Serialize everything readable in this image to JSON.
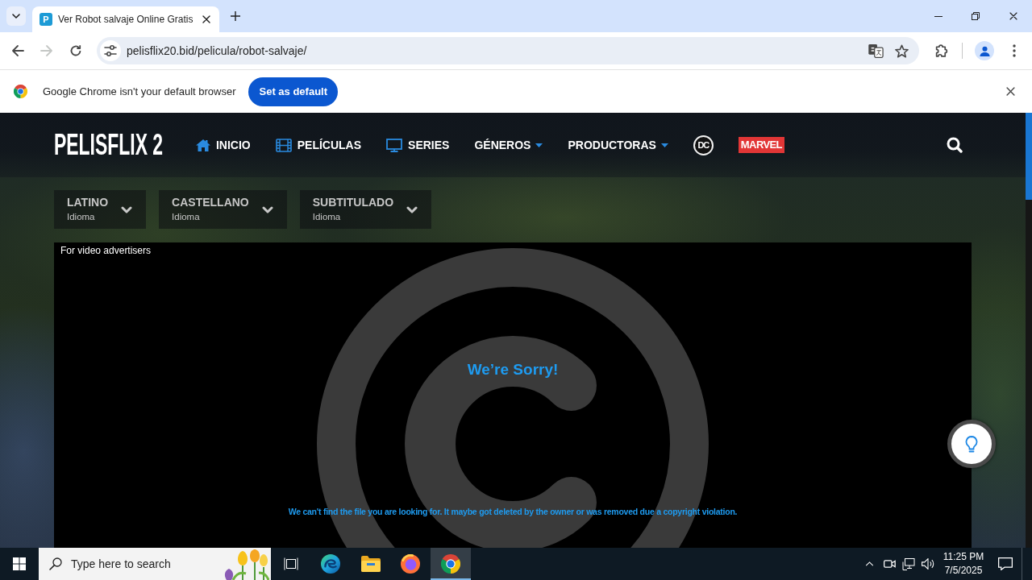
{
  "browser": {
    "tabs": [
      {
        "title": "Ver Robot salvaje Online Gratis",
        "favicon_text": "P",
        "selected": true
      }
    ],
    "toolbar": {
      "buttons": [
        {
          "kind": "back",
          "disabled": false
        },
        {
          "kind": "forward",
          "disabled": true
        },
        {
          "kind": "reload",
          "disabled": false
        }
      ],
      "url": "pelisflix20.bid/pelicula/robot-salvaje/"
    },
    "infobar": {
      "message": "Google Chrome isn't your default browser",
      "button": "Set as default"
    }
  },
  "site": {
    "logo": "PELISFLIX 2",
    "nav": [
      {
        "kind": "home",
        "label": "INICIO"
      },
      {
        "kind": "film",
        "label": "PELÍCULAS"
      },
      {
        "kind": "tv",
        "label": "SERIES"
      },
      {
        "kind": "dropdown",
        "label": "GÉNEROS"
      },
      {
        "kind": "dropdown",
        "label": "PRODUCTORAS"
      },
      {
        "kind": "circle-logo",
        "label": "DC"
      },
      {
        "kind": "box-logo",
        "label": "MARVEL"
      }
    ],
    "languages": [
      {
        "title": "LATINO",
        "subtitle": "Idioma"
      },
      {
        "title": "CASTELLANO",
        "subtitle": "Idioma"
      },
      {
        "title": "SUBTITULADO",
        "subtitle": "Idioma"
      }
    ],
    "player": {
      "label": "For video advertisers",
      "title": "We’re Sorry!",
      "message": "We can't find the file you are looking for. It maybe got deleted by the owner or was removed due a copyright violation."
    }
  },
  "taskbar": {
    "search": {
      "placeholder": "Type here to search"
    },
    "apps": [
      {
        "kind": "task-view",
        "selected": false
      },
      {
        "kind": "edge",
        "selected": false
      },
      {
        "kind": "explorer",
        "selected": false
      },
      {
        "kind": "firefox",
        "selected": false
      },
      {
        "kind": "chrome",
        "selected": true
      }
    ],
    "time": "11:25 PM",
    "date": "7/5/2025"
  }
}
